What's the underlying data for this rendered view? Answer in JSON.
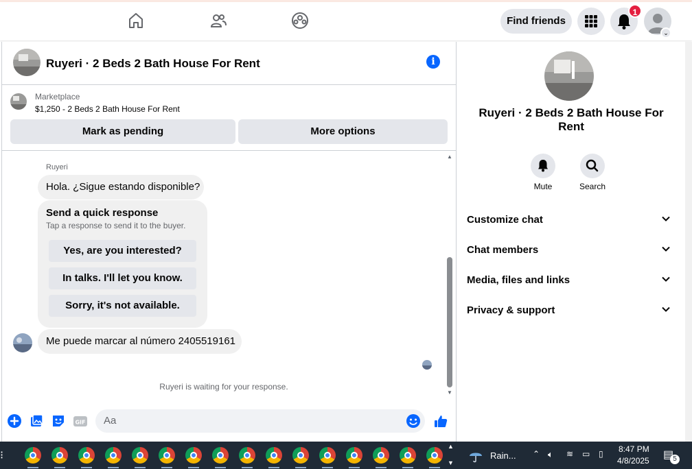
{
  "topnav": {
    "find_friends": "Find friends",
    "notif_count": "1"
  },
  "chat": {
    "title": "Ruyeri · 2 Beds 2 Bath House For Rent",
    "marketplace_label": "Marketplace",
    "listing": "$1,250 - 2 Beds 2 Bath House For Rent",
    "mark_pending": "Mark as pending",
    "more_options": "More options",
    "sender": "Ruyeri",
    "messages": [
      "Hola. ¿Sigue estando disponible?",
      "Me puede marcar al número 2405519161"
    ],
    "quick": {
      "title": "Send a quick response",
      "subtitle": "Tap a response to send it to the buyer.",
      "options": [
        "Yes, are you interested?",
        "In talks. I'll let you know.",
        "Sorry, it's not available."
      ]
    },
    "waiting": "Ruyeri is waiting for your response.",
    "composer_placeholder": "Aa"
  },
  "side": {
    "title": "Ruyeri · 2 Beds 2 Bath House For Rent",
    "mute": "Mute",
    "search": "Search",
    "sections": [
      "Customize chat",
      "Chat members",
      "Media, files and links",
      "Privacy & support"
    ]
  },
  "taskbar": {
    "weather": "Rain...",
    "time": "8:47 PM",
    "date": "4/8/2025",
    "notif_count": "5"
  },
  "colors": {
    "accent": "#0866ff",
    "badge": "#e41e3f",
    "bubble": "#f0f0f0",
    "button": "#e4e6eb"
  }
}
